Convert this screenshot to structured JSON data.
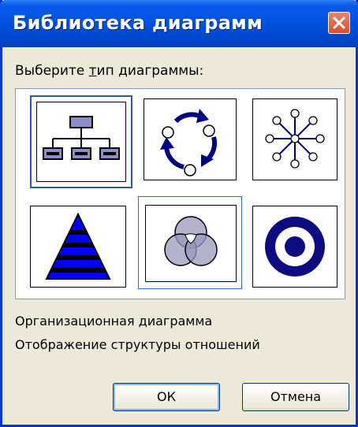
{
  "window": {
    "title": "Библиотека диаграмм"
  },
  "prompt": {
    "before": "Выберите ",
    "underlined": "т",
    "after": "ип диаграммы:"
  },
  "diagram_types": [
    {
      "id": "organization-chart",
      "icon": "org-chart-icon",
      "selected": true
    },
    {
      "id": "cycle",
      "icon": "cycle-diagram-icon"
    },
    {
      "id": "radial",
      "icon": "radial-diagram-icon"
    },
    {
      "id": "pyramid",
      "icon": "pyramid-diagram-icon"
    },
    {
      "id": "venn",
      "icon": "venn-diagram-icon"
    },
    {
      "id": "target",
      "icon": "target-diagram-icon"
    }
  ],
  "description": {
    "name": "Организационная диаграмма",
    "text": "Отображение структуры отношений"
  },
  "buttons": {
    "ok": "ОК",
    "cancel": "Отмена"
  },
  "colors": {
    "title_bar": "#0054e3",
    "close": "#d94f28",
    "accent": "#000080",
    "selection": "#2d5a96"
  }
}
